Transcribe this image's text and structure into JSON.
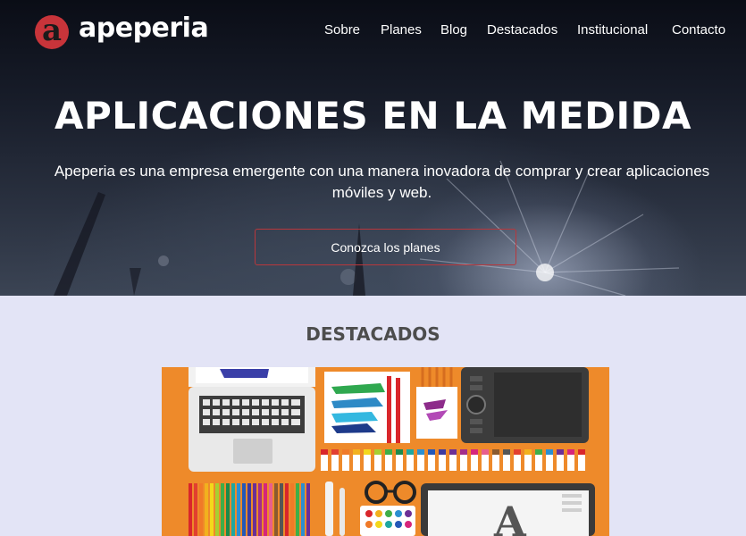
{
  "brand": {
    "logo_letter": "a",
    "name": "apeperia",
    "accent_color": "#c8343a"
  },
  "nav": {
    "items": [
      {
        "label": "Sobre"
      },
      {
        "label": "Planes"
      },
      {
        "label": "Blog"
      },
      {
        "label": "Destacados"
      },
      {
        "label": "Institucional"
      },
      {
        "label": "Contacto"
      }
    ]
  },
  "hero": {
    "title": "APLICACIONES EN LA MEDIDA",
    "subtitle": "Apeperia es una empresa emergente con una manera inovadora de comprar y crear aplicaciones móviles y web.",
    "cta_label": "Conozca los planes"
  },
  "featured": {
    "title": "DESTACADOS",
    "image_icon": "designer-workspace-illustration"
  }
}
